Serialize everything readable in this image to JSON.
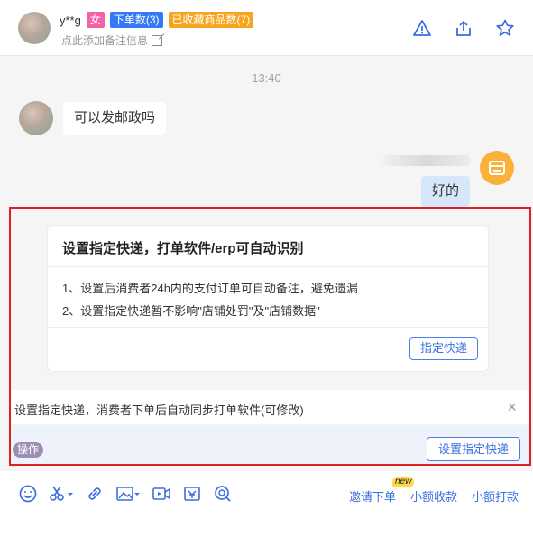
{
  "header": {
    "username": "y**g",
    "tags": {
      "gender": "女",
      "orders": "下单数(3)",
      "favorites": "已收藏商品数(7)"
    },
    "note": "点此添加备注信息",
    "icons": [
      "warning-icon",
      "share-icon",
      "star-icon"
    ]
  },
  "chat": {
    "time": "13:40",
    "messages": [
      {
        "side": "left",
        "text": "可以发邮政吗"
      },
      {
        "side": "right",
        "text": "好的"
      }
    ]
  },
  "express_card": {
    "title": "设置指定快递，打单软件/erp可自动识别",
    "lines": [
      "1、设置后消费者24h内的支付订单可自动备注，避免遗漏",
      "2、设置指定快递暂不影响\"店铺处罚\"及\"店铺数据\""
    ],
    "button": "指定快递"
  },
  "notice": {
    "text": "设置指定快递，消费者下单后自动同步打单软件(可修改)",
    "close": "×"
  },
  "ops": {
    "tag": "操作",
    "button": "设置指定快递"
  },
  "toolbar": {
    "icons": [
      "emoji-icon",
      "scissors-icon",
      "link-icon",
      "image-icon",
      "video-icon",
      "product-icon",
      "search-icon"
    ],
    "links": {
      "invite_order": "邀请下单",
      "new_badge": "new",
      "small_collect": "小额收款",
      "small_pay": "小额打款"
    }
  },
  "colors": {
    "accent": "#3a6fe0",
    "highlight_border": "#e02020",
    "chat_bg": "#f5f5f5",
    "seller_avatar": "#f9b13a"
  }
}
